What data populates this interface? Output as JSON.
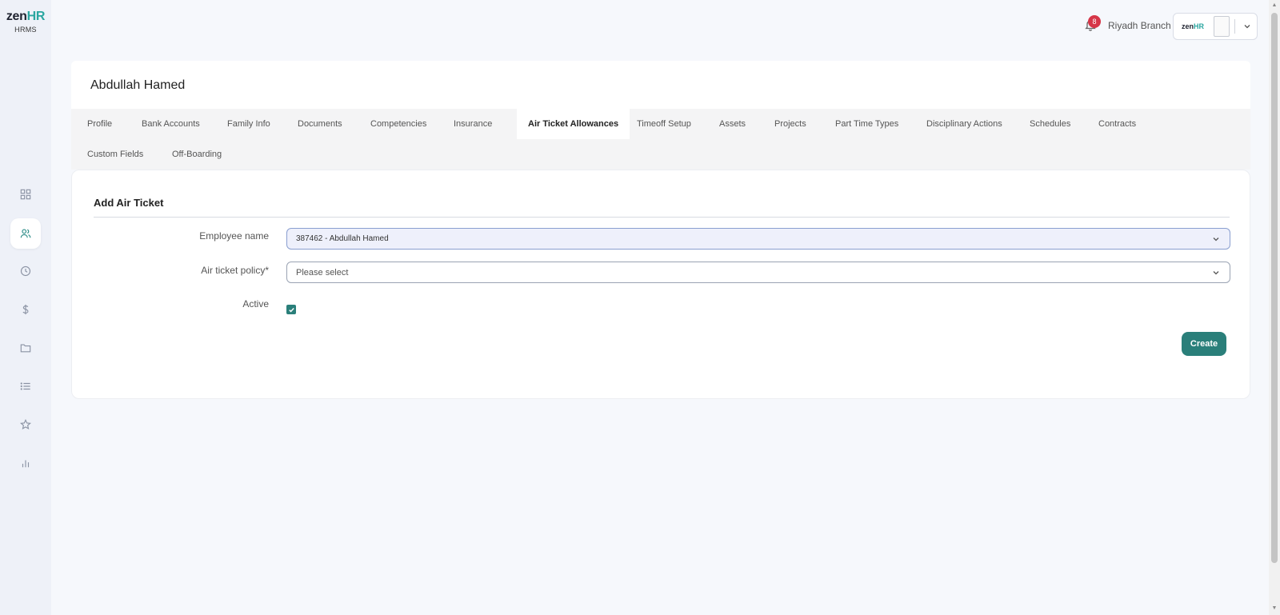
{
  "app": {
    "logo_zen": "zen",
    "logo_hr": "HR",
    "logo_sub": "HRMS"
  },
  "sidebar": {
    "items": [
      {
        "icon": "dashboard-icon",
        "active": false
      },
      {
        "icon": "users-icon",
        "active": true
      },
      {
        "icon": "clock-icon",
        "active": false
      },
      {
        "icon": "dollar-icon",
        "active": false
      },
      {
        "icon": "folder-icon",
        "active": false
      },
      {
        "icon": "list-icon",
        "active": false
      },
      {
        "icon": "star-icon",
        "active": false
      },
      {
        "icon": "bar-chart-icon",
        "active": false
      }
    ]
  },
  "topbar": {
    "notification_count": "8",
    "branch": "Riyadh Branch",
    "account_logo_zen": "zen",
    "account_logo_hr": "HR"
  },
  "employee": {
    "name": "Abdullah Hamed"
  },
  "tabs": [
    {
      "label": "Profile",
      "active": false
    },
    {
      "label": "Bank Accounts",
      "active": false
    },
    {
      "label": "Family Info",
      "active": false
    },
    {
      "label": "Documents",
      "active": false
    },
    {
      "label": "Competencies",
      "active": false
    },
    {
      "label": "Insurance",
      "active": false
    },
    {
      "label": "Air Ticket Allowances",
      "active": true
    },
    {
      "label": "Timeoff Setup",
      "active": false
    },
    {
      "label": "Assets",
      "active": false
    },
    {
      "label": "Projects",
      "active": false
    },
    {
      "label": "Part Time Types",
      "active": false
    },
    {
      "label": "Disciplinary Actions",
      "active": false
    },
    {
      "label": "Schedules",
      "active": false
    },
    {
      "label": "Contracts",
      "active": false
    },
    {
      "label": "Custom Fields",
      "active": false
    },
    {
      "label": "Off-Boarding",
      "active": false
    }
  ],
  "form": {
    "title": "Add Air Ticket",
    "employee_label": "Employee name",
    "employee_value": "387462 - Abdullah Hamed",
    "policy_label": "Air ticket policy",
    "policy_required": "*",
    "policy_placeholder": "Please select",
    "active_label": "Active",
    "active_checked": true,
    "create_label": "Create"
  },
  "colors": {
    "accent": "#2a7f7a",
    "brand_hr": "#2aa6a0",
    "badge": "#d63648"
  }
}
